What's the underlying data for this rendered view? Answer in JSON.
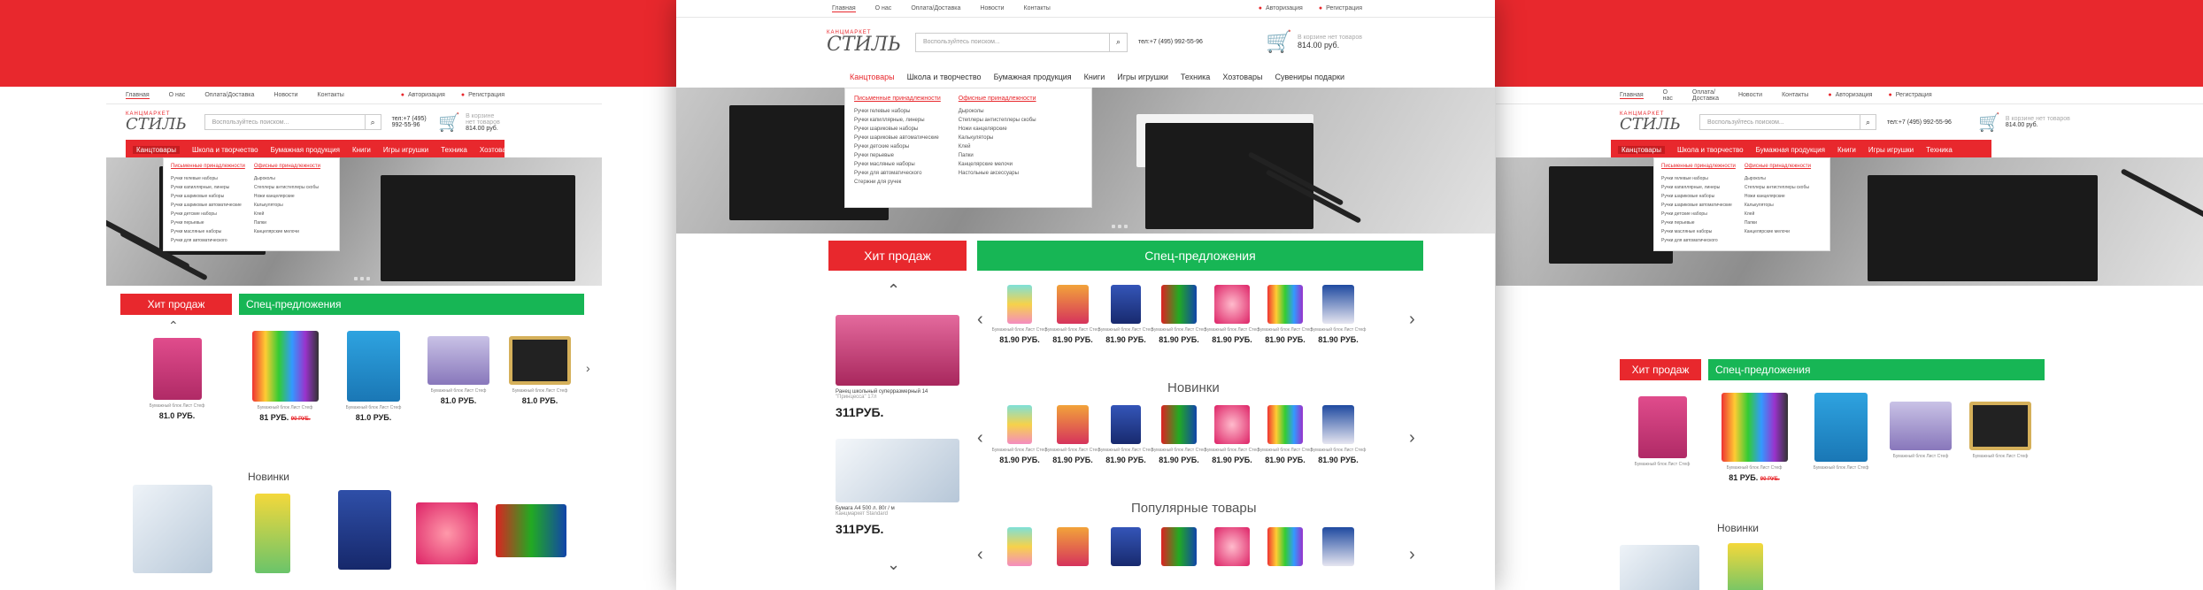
{
  "colors": {
    "accent": "#e8282d",
    "green": "#17b655"
  },
  "topbar": {
    "links": [
      "Главная",
      "О нас",
      "Оплата/Доставка",
      "Новости",
      "Контакты"
    ],
    "login": "Авторизация",
    "register": "Регистрация"
  },
  "header": {
    "logo_top": "КАНЦМАРКЕТ",
    "logo_main": "СТИЛЬ",
    "search_placeholder": "Воспользуйтесь поиском...",
    "phone": "тел:+7 (495) 992-55-96",
    "cart_label": "В корзине нет товаров",
    "cart_sum": "814.00 руб.",
    "icons": {
      "search": "search-icon",
      "cart": "basket-icon"
    }
  },
  "nav": [
    "Канцтовары",
    "Школа и творчество",
    "Бумажная продукция",
    "Книги",
    "Игры игрушки",
    "Техника",
    "Хозтовары",
    "Сувениры подарки"
  ],
  "dropdown": {
    "col1_head": "Письменные принадлежности",
    "col1": [
      "Ручки гелевые наборы",
      "Ручки капиллярные, линеры",
      "Ручки шариковые наборы",
      "Ручки шариковые автоматические",
      "Ручки детские наборы",
      "Ручки перьевые",
      "Ручки масляные наборы",
      "Ручки для автоматического",
      "Стержни для ручек"
    ],
    "col2_head": "Офисные принадлежности",
    "col2": [
      "Дыроколы",
      "Степлеры антистеплеры скобы",
      "Ножи канцелярские",
      "Калькуляторы",
      "Клей",
      "Папки",
      "Канцелярские мелочи",
      "Настольные аксессуары"
    ]
  },
  "blocks": {
    "hit": "Хит продаж",
    "hit_short": "Хит продаж",
    "special": "Спец-предложения",
    "new": "Новинки",
    "popular": "Популярные товары"
  },
  "product": {
    "name": "Бумажный блок Лист Стеф",
    "price": "81.90 РУБ.",
    "price_short": "81 РУБ.",
    "price_side": "81.0 РУБ.",
    "old_price": "90 РУБ."
  },
  "lead": {
    "item1_name": "Ранец школьный суперразмерный 14",
    "item1_sub": "\"Принцесса\" 17л",
    "item1_price": "311РУБ.",
    "item2_name": "Бумага А4 500 л. 80г / м",
    "item2_sub": "Канцмаркет Standard",
    "item2_price": "311РУБ."
  }
}
